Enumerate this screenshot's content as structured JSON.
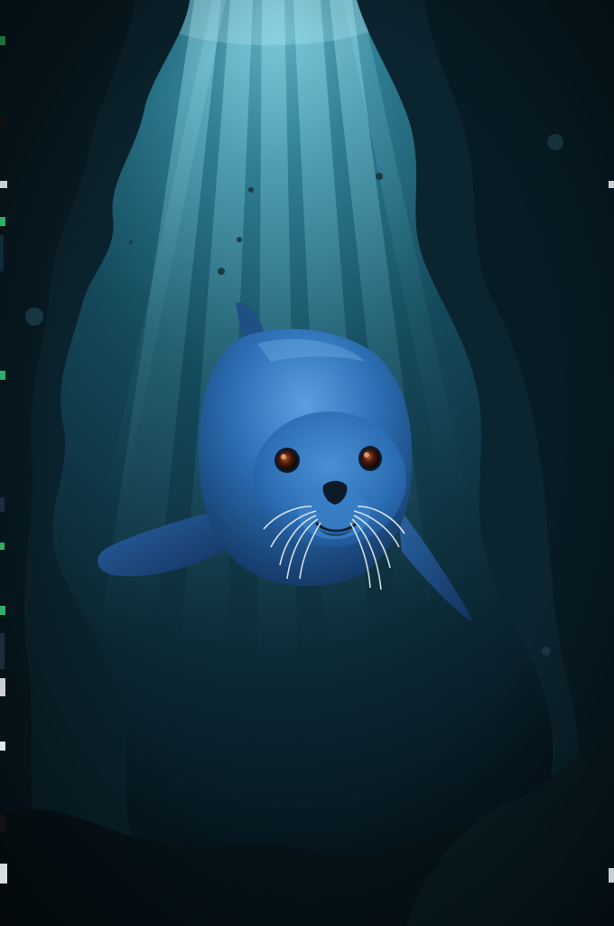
{
  "scene": {
    "subject": "seal-underwater",
    "palette": {
      "water_light": "#2f7e94",
      "water_mid": "#154a5c",
      "water_deep": "#0a2430",
      "rock_dark": "#071820",
      "rock_mid": "#10303b",
      "seal_body": "#2c6fb5",
      "seal_shadow": "#173f76",
      "seal_highlight": "#5b9fe0",
      "eye": "#2a0c06",
      "eye_glint": "#c9825a",
      "whisker": "#e8eef2",
      "ray": "#7fd4e6"
    }
  }
}
